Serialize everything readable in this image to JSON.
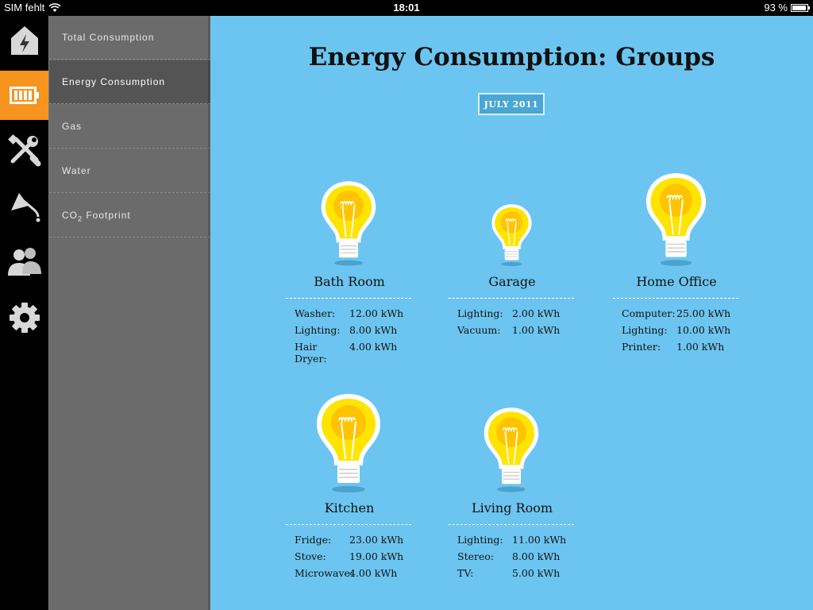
{
  "status_bar": {
    "carrier": "SIM fehlt",
    "time": "18:01",
    "battery": "93 %"
  },
  "icon_bar": [
    {
      "name": "home-energy-icon"
    },
    {
      "name": "battery-icon",
      "active": true
    },
    {
      "name": "tools-icon"
    },
    {
      "name": "shower-icon"
    },
    {
      "name": "people-icon"
    },
    {
      "name": "gear-icon"
    }
  ],
  "menu": {
    "items": [
      {
        "label": "Total Consumption"
      },
      {
        "label": "Energy Consumption",
        "active": true
      },
      {
        "label": "Gas"
      },
      {
        "label": "Water"
      },
      {
        "label": "CO",
        "sub": "2",
        "suffix": " Footprint"
      }
    ]
  },
  "main": {
    "title": "Energy Consumption: Groups",
    "date": "JULY 2011",
    "groups": [
      {
        "name": "Bath Room",
        "total_kwh": 24,
        "items": [
          {
            "label": "Washer:",
            "value": "12.00 kWh"
          },
          {
            "label": "Lighting:",
            "value": "8.00 kWh"
          },
          {
            "label": "Hair Dryer:",
            "value": "4.00 kWh"
          }
        ]
      },
      {
        "name": "Garage",
        "total_kwh": 3,
        "items": [
          {
            "label": "Lighting:",
            "value": "2.00 kWh"
          },
          {
            "label": "Vacuum:",
            "value": "1.00 kWh"
          }
        ]
      },
      {
        "name": "Home Office",
        "total_kwh": 36,
        "items": [
          {
            "label": "Computer:",
            "value": "25.00 kWh"
          },
          {
            "label": "Lighting:",
            "value": "10.00 kWh"
          },
          {
            "label": "Printer:",
            "value": "1.00 kWh"
          }
        ]
      },
      {
        "name": "Kitchen",
        "total_kwh": 46,
        "items": [
          {
            "label": "Fridge:",
            "value": "23.00 kWh"
          },
          {
            "label": "Stove:",
            "value": "19.00 kWh"
          },
          {
            "label": "Microwave:",
            "value": "4.00 kWh"
          }
        ]
      },
      {
        "name": "Living Room",
        "total_kwh": 24,
        "items": [
          {
            "label": "Lighting:",
            "value": "11.00 kWh"
          },
          {
            "label": "Stereo:",
            "value": "8.00 kWh"
          },
          {
            "label": "TV:",
            "value": "5.00 kWh"
          }
        ]
      }
    ]
  },
  "colors": {
    "accent": "#f7941d",
    "panel": "#6cc5f0",
    "menu": "#6b6b6b",
    "bulb_outer": "#ffe400",
    "bulb_inner": "#ffc400"
  }
}
